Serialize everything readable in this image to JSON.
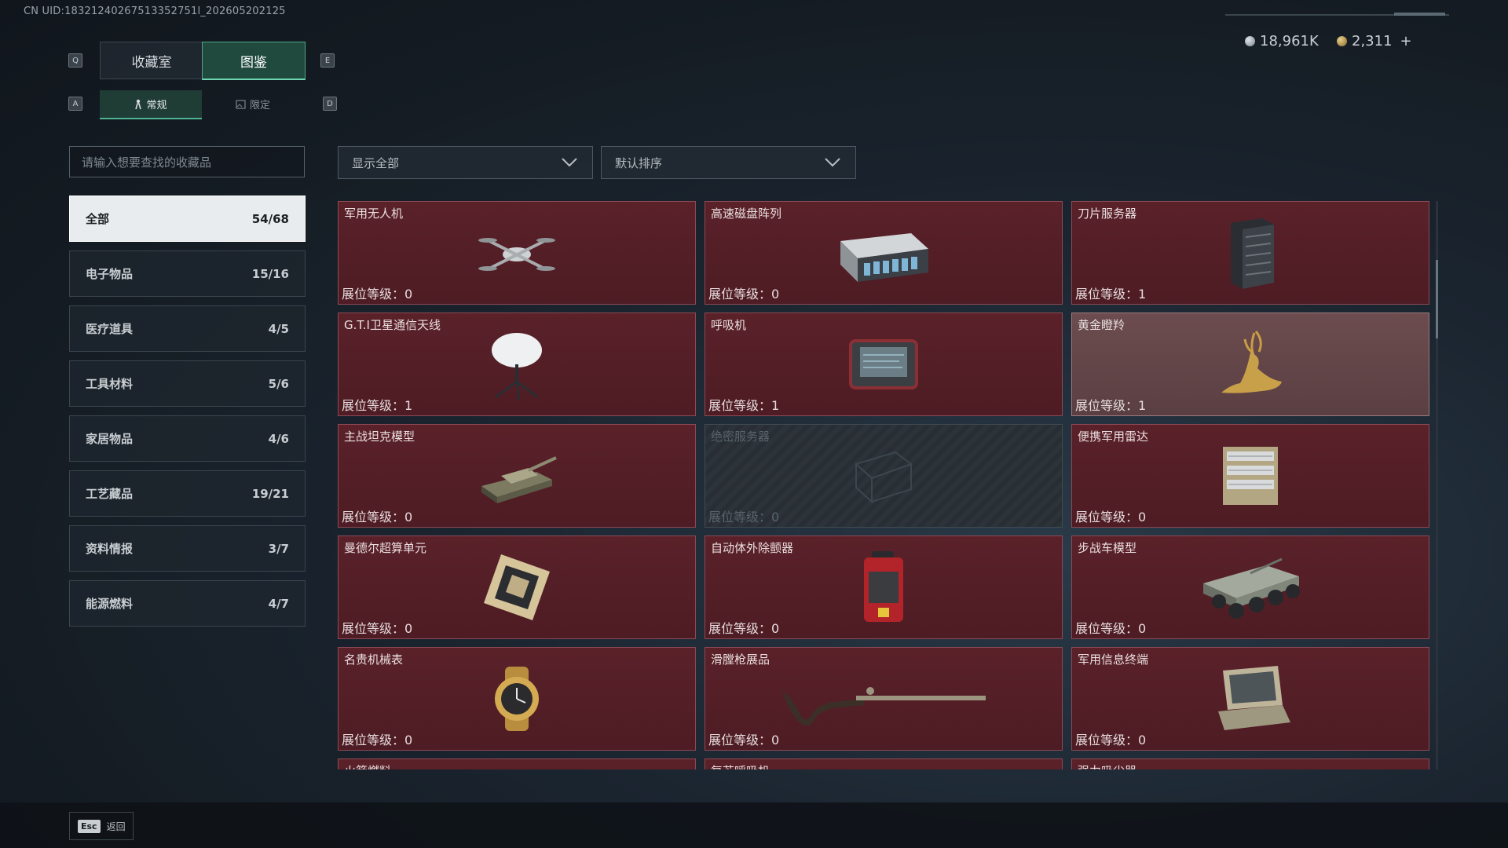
{
  "uid": "CN UID:18321240267513352751l_202605202125",
  "currency": {
    "silver": "18,961K",
    "gold": "2,311",
    "plus": "+"
  },
  "keys": {
    "prev_tab": "Q",
    "next_tab": "E",
    "prev_sub": "A",
    "next_sub": "D"
  },
  "tabs": [
    {
      "label": "收藏室"
    },
    {
      "label": "图鉴"
    }
  ],
  "subtabs": [
    {
      "label": "常规"
    },
    {
      "label": "限定"
    }
  ],
  "search": {
    "placeholder": "请输入想要查找的收藏品"
  },
  "filters": {
    "show": "显示全部",
    "sort": "默认排序"
  },
  "categories": [
    {
      "label": "全部",
      "count": "54/68"
    },
    {
      "label": "电子物品",
      "count": "15/16"
    },
    {
      "label": "医疗道具",
      "count": "4/5"
    },
    {
      "label": "工具材料",
      "count": "5/6"
    },
    {
      "label": "家居物品",
      "count": "4/6"
    },
    {
      "label": "工艺藏品",
      "count": "19/21"
    },
    {
      "label": "资料情报",
      "count": "3/7"
    },
    {
      "label": "能源燃料",
      "count": "4/7"
    }
  ],
  "items": [
    {
      "name": "军用无人机",
      "level": "展位等级：0",
      "icon": "drone-icon"
    },
    {
      "name": "高速磁盘阵列",
      "level": "展位等级：0",
      "icon": "disk-array-icon"
    },
    {
      "name": "刀片服务器",
      "level": "展位等级：1",
      "icon": "server-icon"
    },
    {
      "name": "G.T.I卫星通信天线",
      "level": "展位等级：1",
      "icon": "satellite-dish-icon"
    },
    {
      "name": "呼吸机",
      "level": "展位等级：1",
      "icon": "ventilator-icon"
    },
    {
      "name": "黄金瞪羚",
      "level": "展位等级：1",
      "icon": "gazelle-icon"
    },
    {
      "name": "主战坦克模型",
      "level": "展位等级：0",
      "icon": "tank-icon"
    },
    {
      "name": "绝密服务器",
      "level": "展位等级：0",
      "icon": "locked-server-icon"
    },
    {
      "name": "便携军用雷达",
      "level": "展位等级：0",
      "icon": "radar-icon"
    },
    {
      "name": "曼德尔超算单元",
      "level": "展位等级：0",
      "icon": "cpu-icon"
    },
    {
      "name": "自动体外除颤器",
      "level": "展位等级：0",
      "icon": "defibrillator-icon"
    },
    {
      "name": "步战车模型",
      "level": "展位等级：0",
      "icon": "ifv-icon"
    },
    {
      "name": "名贵机械表",
      "level": "展位等级：0",
      "icon": "watch-icon"
    },
    {
      "name": "滑膛枪展品",
      "level": "展位等级：0",
      "icon": "musket-icon"
    },
    {
      "name": "军用信息终端",
      "level": "展位等级：0",
      "icon": "terminal-icon"
    },
    {
      "name": "火箭燃料",
      "level": "",
      "icon": ""
    },
    {
      "name": "复苏呼吸机",
      "level": "",
      "icon": ""
    },
    {
      "name": "强力吸尘器",
      "level": "",
      "icon": ""
    }
  ],
  "footer": {
    "key": "Esc",
    "label": "返回"
  },
  "colors": {
    "card": "#5a2129",
    "card_border": "#8c4a55",
    "accent": "#6fd4b0"
  }
}
